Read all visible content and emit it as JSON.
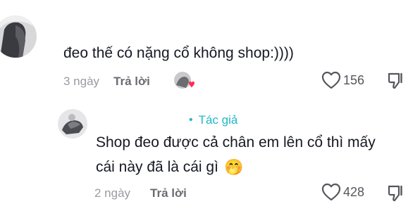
{
  "comments": [
    {
      "text": "đeo thế có nặng cổ không shop:))))",
      "time": "3 ngày",
      "reply_label": "Trả lời",
      "like_count": "156",
      "liked_by_author": true
    },
    {
      "author_tag": "Tác giả",
      "text_line1": "Shop đeo được cả chân em lên cổ thì mấy",
      "text_line2": "cái này đã là cái gì",
      "emoji": "🤭",
      "time": "2 ngày",
      "reply_label": "Trả lời",
      "like_count": "428"
    }
  ],
  "icons": {
    "like": "heart-outline-icon",
    "dislike": "thumbs-down-outline-icon",
    "author_liked": "heart-filled-icon"
  },
  "colors": {
    "author_tag": "#20b8c8",
    "liked_heart": "#fe2c55",
    "secondary_text": "#8a8b91"
  }
}
